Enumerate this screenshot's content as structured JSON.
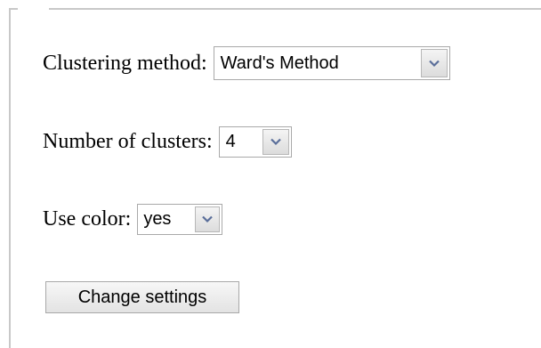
{
  "form": {
    "method_label": "Clustering method:",
    "method_value": "Ward's Method",
    "clusters_label": "Number of clusters:",
    "clusters_value": "4",
    "color_label": "Use color:",
    "color_value": "yes",
    "submit_label": "Change settings"
  },
  "icons": {
    "dropdown": "chevron-down-icon"
  },
  "colors": {
    "border": "#c8c8c8",
    "arrow_glyph": "#5a6e9a"
  }
}
